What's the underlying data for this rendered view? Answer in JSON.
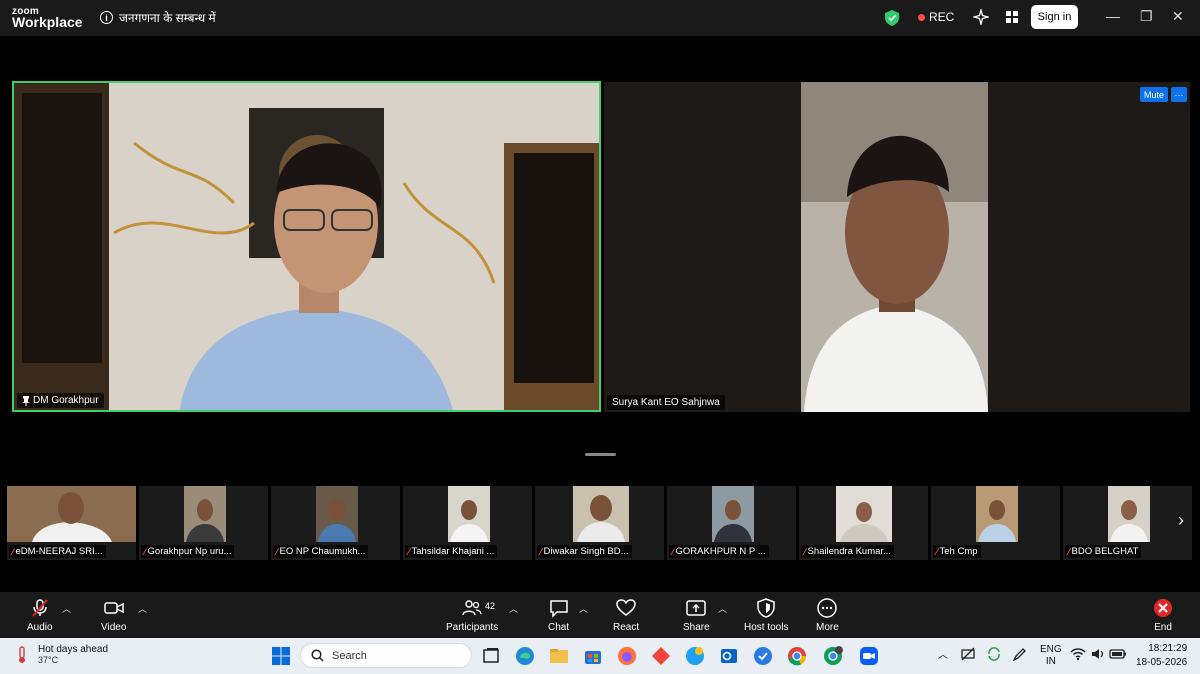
{
  "window": {
    "brand_line1": "zoom",
    "brand_line2": "Workplace",
    "meeting_topic": "जनगणना के सम्बन्ध में",
    "rec_label": "REC",
    "sign_in_label": "Sign in"
  },
  "main": {
    "speaker_name": "DM Gorakhpur",
    "second_name": "Surya Kant EO Sahjnwa",
    "mute_label": "Mute",
    "more_label": "···"
  },
  "thumbnails": [
    {
      "name": "eDM-NEERAJ SRI..."
    },
    {
      "name": "Gorakhpur Np uru..."
    },
    {
      "name": "EO NP Chaumukh..."
    },
    {
      "name": "Tahsildar Khajani ..."
    },
    {
      "name": "Diwakar Singh BD..."
    },
    {
      "name": "GORAKHPUR N P ..."
    },
    {
      "name": "Shailendra Kumar..."
    },
    {
      "name": "Teh Cmp"
    },
    {
      "name": "BDO BELGHAT"
    }
  ],
  "toolbar": {
    "audio": "Audio",
    "video": "Video",
    "participants": "Participants",
    "participants_count": "42",
    "chat": "Chat",
    "react": "React",
    "share": "Share",
    "host_tools": "Host tools",
    "more": "More",
    "end": "End"
  },
  "taskbar": {
    "weather_title": "Hot days ahead",
    "weather_temp": "37°C",
    "search_placeholder": "Search",
    "lang_line1": "ENG",
    "lang_line2": "IN",
    "time": "18:21:29",
    "date": "18-05-2026"
  },
  "colors": {
    "active_speaker_border": "#3fcf6f",
    "mute_button": "#0e72ed",
    "end_red": "#e02828"
  }
}
